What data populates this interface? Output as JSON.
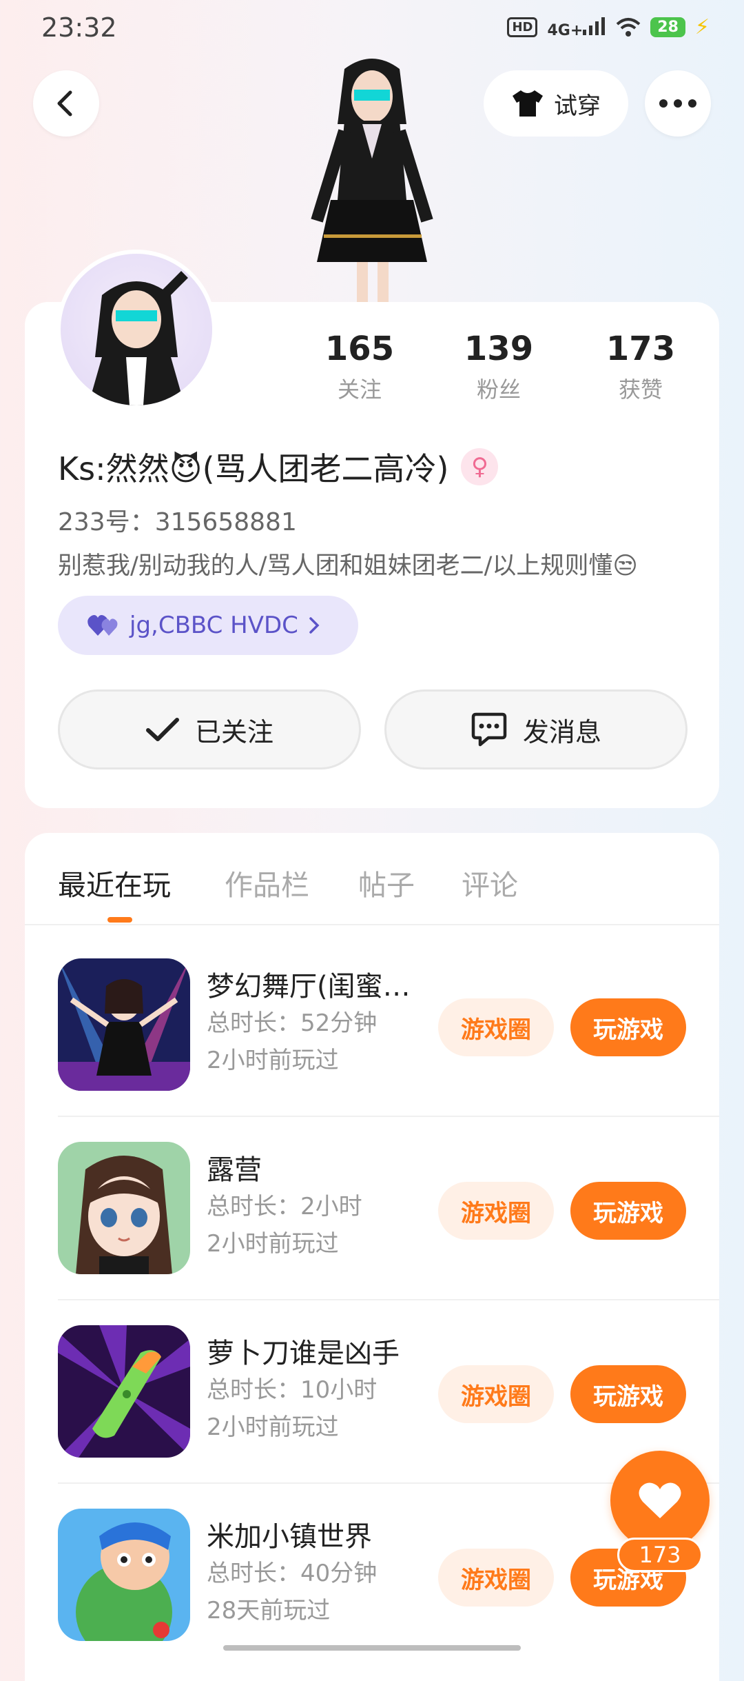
{
  "status_bar": {
    "time": "23:32",
    "hd": "HD",
    "network": "4G+",
    "battery": "28",
    "icons": [
      "hd-icon",
      "signal-icon",
      "wifi-icon",
      "battery-icon",
      "charging-icon"
    ]
  },
  "header": {
    "back_icon": "chevron-left-icon",
    "tryon_label": "试穿",
    "tryon_icon": "tshirt-icon",
    "more_icon": "more-horizontal-icon"
  },
  "profile": {
    "stats": [
      {
        "value": "165",
        "label": "关注"
      },
      {
        "value": "139",
        "label": "粉丝"
      },
      {
        "value": "173",
        "label": "获赞"
      }
    ],
    "nickname": "Ks:然然😈(骂人团老二高冷)",
    "gender_icon": "female-icon",
    "uid": "233号：315658881",
    "bio": "别惹我/别动我的人/骂人团和姐妹团老二/以上规则懂😒",
    "group_label": "jg,CBBC HVDC",
    "follow_label": "已关注",
    "message_label": "发消息"
  },
  "tabs": [
    {
      "label": "最近在玩",
      "active": true
    },
    {
      "label": "作品栏",
      "active": false
    },
    {
      "label": "帖子",
      "active": false
    },
    {
      "label": "评论",
      "active": false
    }
  ],
  "games": [
    {
      "name": "梦幻舞厅(闺蜜…",
      "duration": "总时长：52分钟",
      "last_played": "2小时前玩过",
      "circle_label": "游戏圈",
      "play_label": "玩游戏"
    },
    {
      "name": "露营",
      "duration": "总时长：2小时",
      "last_played": "2小时前玩过",
      "circle_label": "游戏圈",
      "play_label": "玩游戏"
    },
    {
      "name": "萝卜刀谁是凶手",
      "duration": "总时长：10小时",
      "last_played": "2小时前玩过",
      "circle_label": "游戏圈",
      "play_label": "玩游戏"
    },
    {
      "name": "米加小镇世界",
      "duration": "总时长：40分钟",
      "last_played": "28天前玩过",
      "circle_label": "游戏圈",
      "play_label": "玩游戏"
    }
  ],
  "like_fab": {
    "count": "173",
    "icon": "heart-icon"
  },
  "colors": {
    "accent": "#ff7a1a",
    "accent_light": "#fff0e6",
    "group_pill": "#e9e6fb",
    "group_text": "#5b53c8"
  }
}
